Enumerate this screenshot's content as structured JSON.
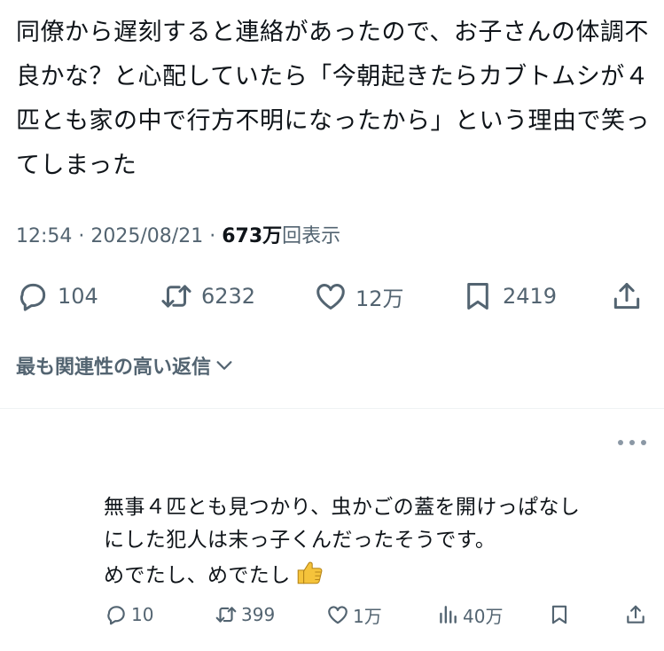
{
  "tweet": {
    "text": "同僚から遅刻すると連絡があったので、お子さんの体調不良かな？と心配していたら「今朝起きたらカブトムシが４匹とも家の中で行方不明になったから」という理由で笑ってしまった",
    "time": "12:54",
    "date": "2025/08/21",
    "views": "673万",
    "views_label": "回表示",
    "separator": "·"
  },
  "actions": {
    "replies": "104",
    "retweets": "6232",
    "likes": "12万",
    "bookmarks": "2419"
  },
  "relevance": {
    "label": "最も関連性の高い返信"
  },
  "reply": {
    "line1": "無事４匹とも見つかり、虫かごの蓋を開けっぱなし",
    "line2": "にした犯人は末っ子くんだったそうです。",
    "line3": "めでたし、めでたし",
    "emoji": "thumbs-up",
    "replies": "10",
    "retweets": "399",
    "likes": "1万",
    "views": "40万"
  },
  "colors": {
    "text": "#0f1419",
    "muted": "#536471",
    "divider": "#eff3f4",
    "thumb": "#f5c33b"
  }
}
